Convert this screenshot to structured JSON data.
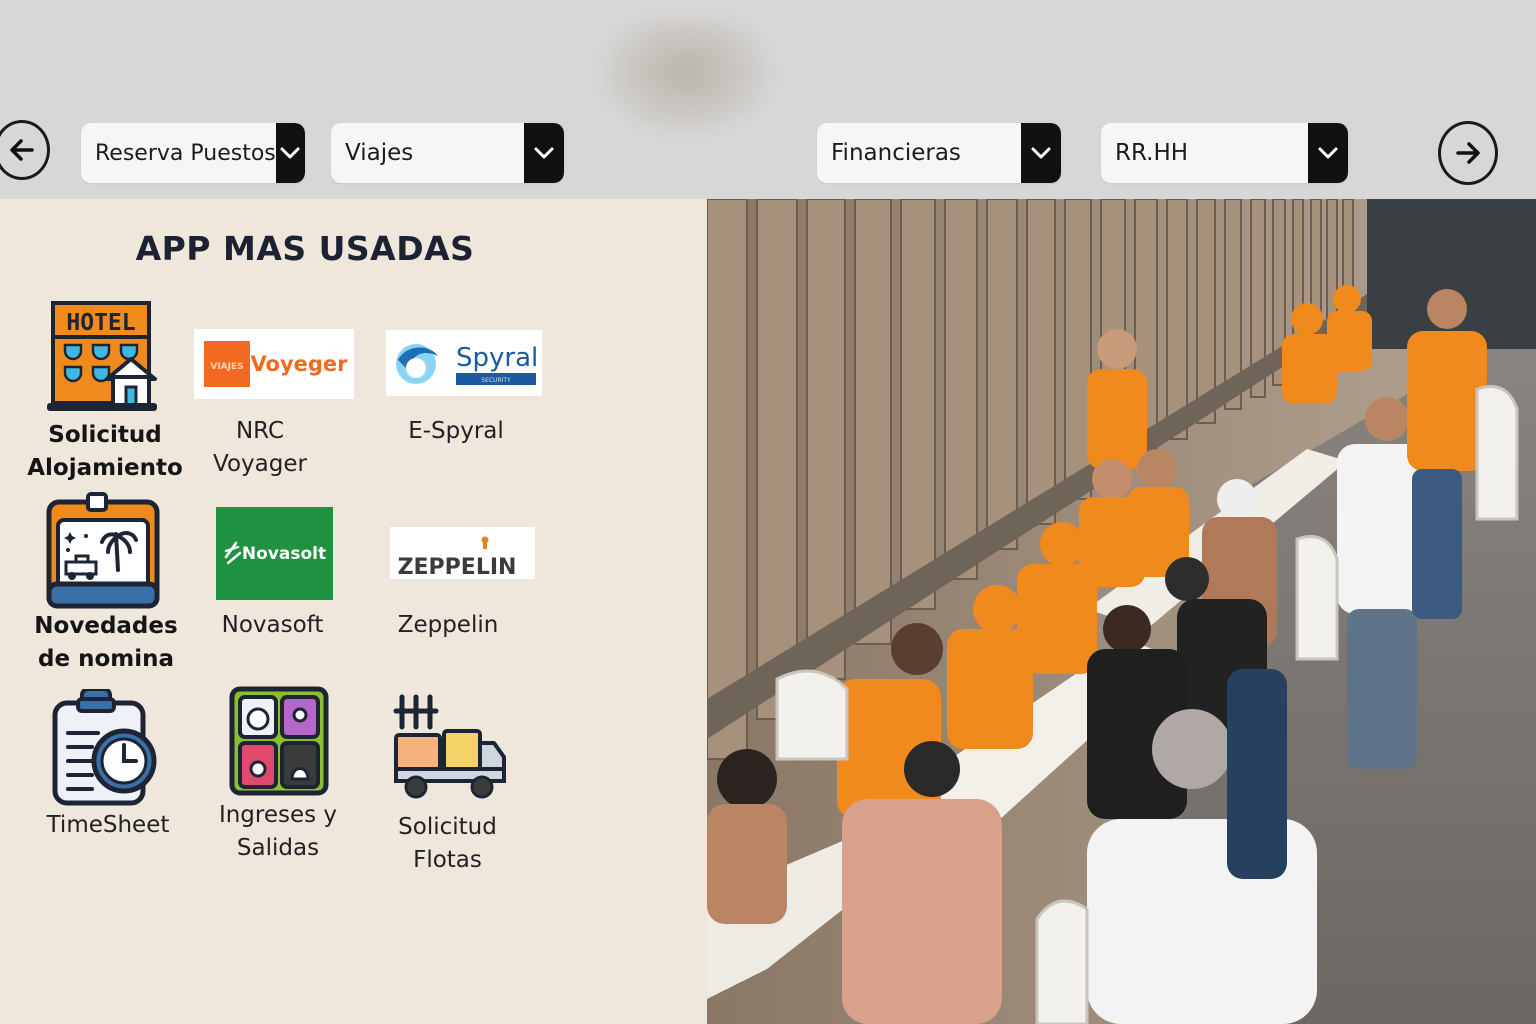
{
  "header": {
    "prev_icon": "arrow-left-icon",
    "next_icon": "arrow-right-icon",
    "dropdowns": [
      {
        "label": "Reserva Puestos"
      },
      {
        "label": "Viajes"
      },
      {
        "label": "Financieras"
      },
      {
        "label": "RR.HH"
      }
    ],
    "dropdown_icon": "chevron-down-icon"
  },
  "apps_panel": {
    "title": "APP MAS USADAS",
    "apps": [
      {
        "label_line1": "Solicitud",
        "label_line2": "Alojamiento",
        "icon": "hotel-icon",
        "icon_text": "HOTEL"
      },
      {
        "label_line1": "NRC",
        "label_line2": "Voyager",
        "icon": "voyager-logo",
        "logo_text": "Voyeger",
        "logo_badge": "VIAJES"
      },
      {
        "label_line1": "E-Spyral",
        "icon": "spyral-logo",
        "logo_text": "Spyral",
        "logo_subtext": "SECURITY"
      },
      {
        "label_line1": "Novedades",
        "label_line2": "de nomina",
        "icon": "payroll-news-icon"
      },
      {
        "label_line1": "Novasoft",
        "icon": "novasoft-logo",
        "logo_text": "Novasolt"
      },
      {
        "label_line1": "Zeppelin",
        "icon": "zeppelin-logo",
        "logo_text": "ZEPPELIN"
      },
      {
        "label_line1": "TimeSheet",
        "icon": "timesheet-icon"
      },
      {
        "label_line1": "Ingreses y",
        "label_line2": "Salidas",
        "icon": "entries-exits-icon"
      },
      {
        "label_line1": "Solicitud",
        "label_line2": "Flotas",
        "icon": "fleet-truck-icon"
      }
    ]
  },
  "photo": {
    "icon": "event-photo"
  },
  "colors": {
    "header_bg": "#d8d7d8",
    "panel_bg": "#efe6dc",
    "orange": "#f08a1d",
    "dark": "#111111",
    "novasoft_green": "#1f9241"
  }
}
